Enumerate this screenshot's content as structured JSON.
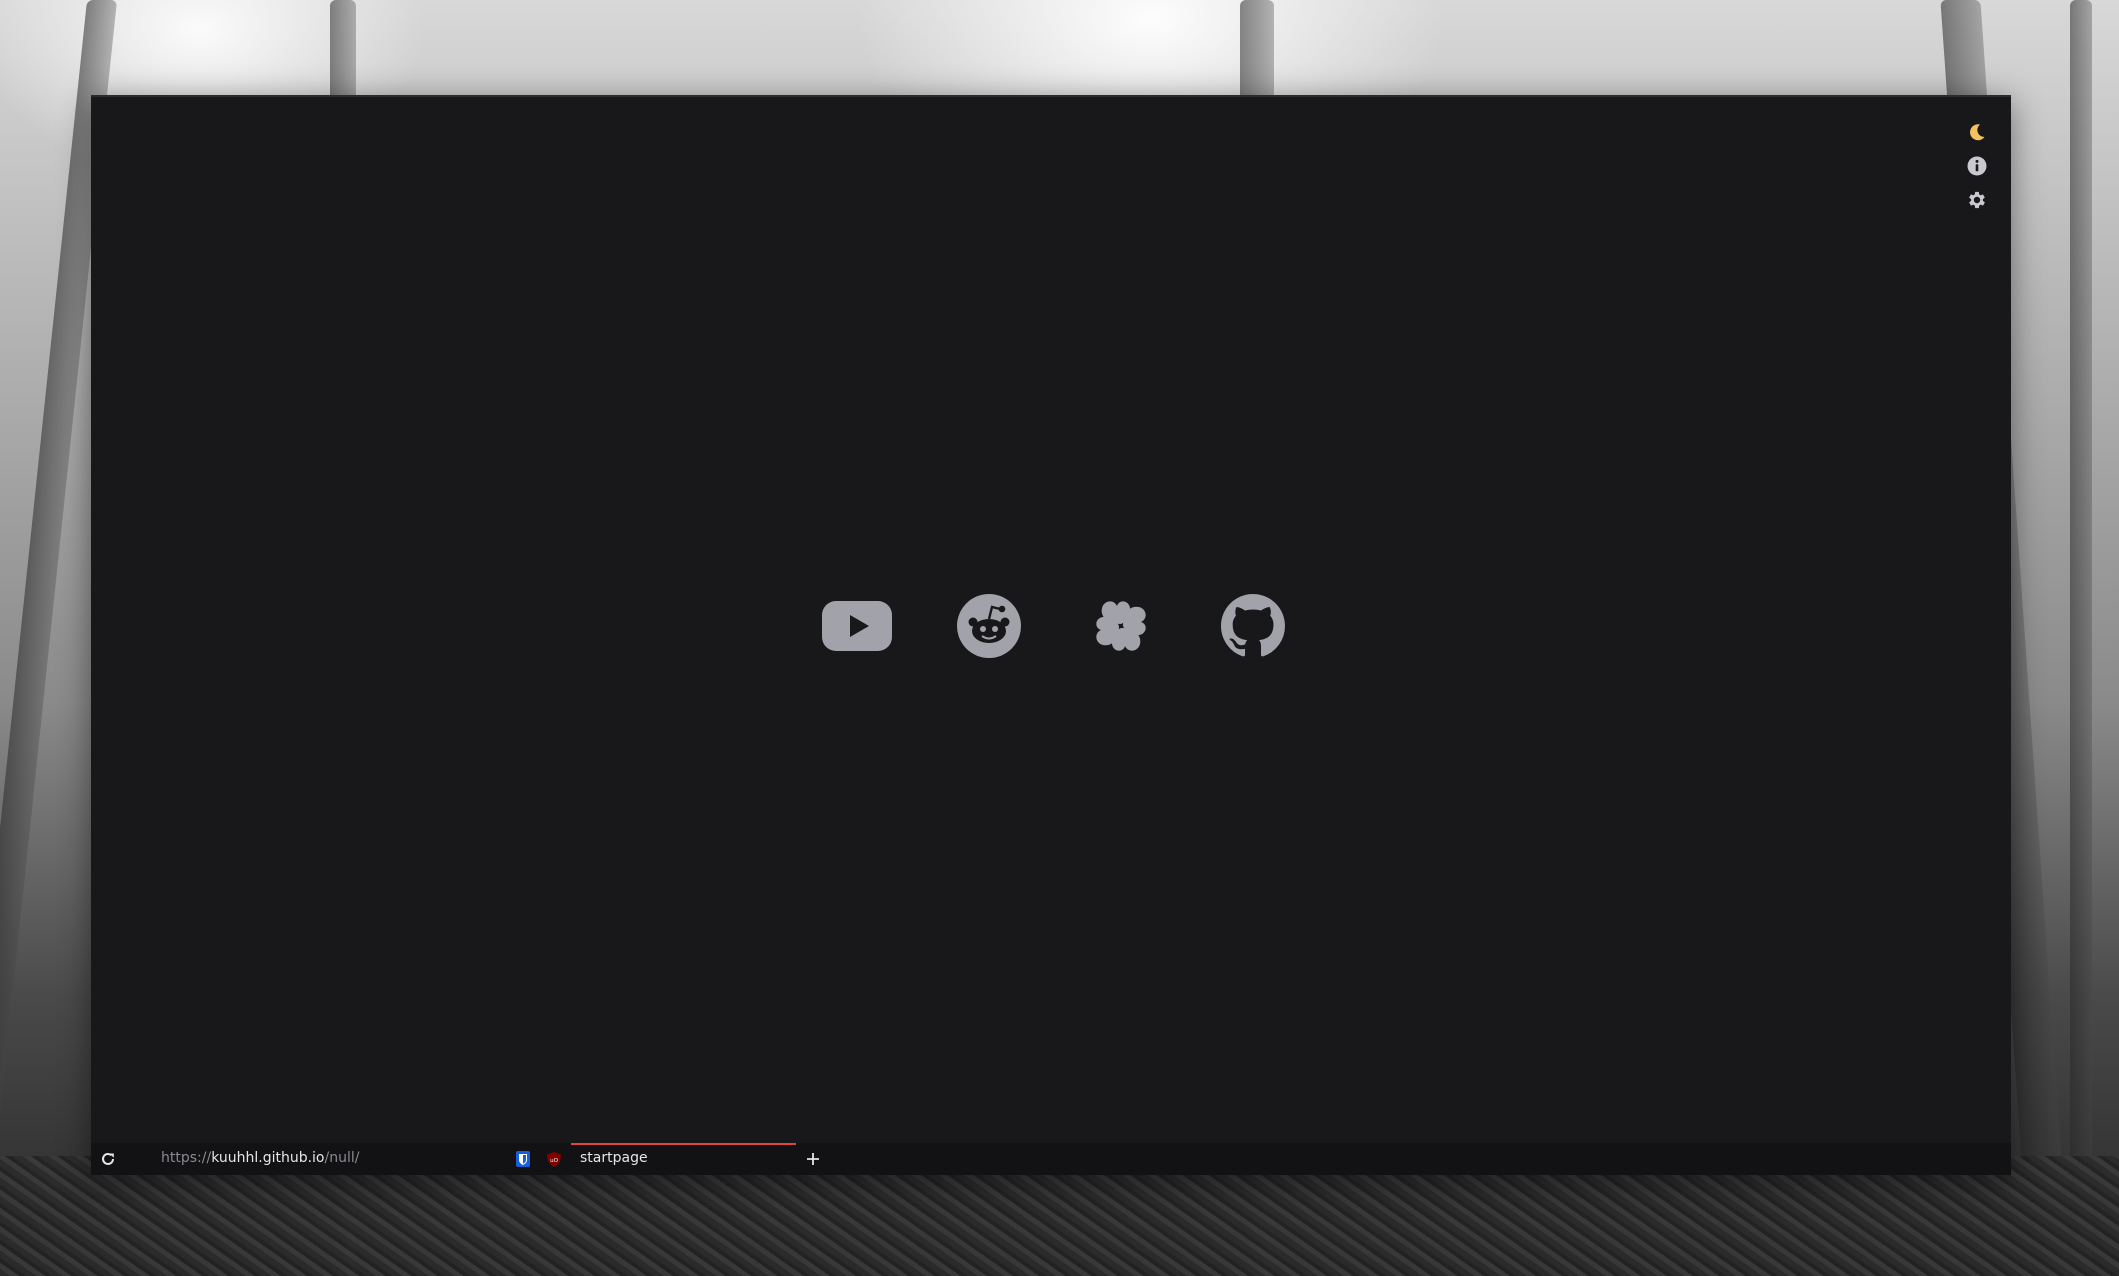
{
  "side_icons": [
    {
      "icon": "moon-icon",
      "color": "#f2c25f"
    },
    {
      "icon": "info-icon",
      "color": "#c9c9cf"
    },
    {
      "icon": "gear-icon",
      "color": "#c9c9cf"
    }
  ],
  "links": [
    {
      "icon": "youtube-icon"
    },
    {
      "icon": "reddit-icon"
    },
    {
      "icon": "clover-icon"
    },
    {
      "icon": "github-icon"
    }
  ],
  "link_color": "#a2a2aa",
  "statusbar": {
    "url_scheme": "https://",
    "url_host": "kuuhhl.github.io",
    "url_path": "/null/",
    "extensions": [
      {
        "icon": "bitwarden-icon",
        "color": "#175ddc"
      },
      {
        "icon": "ublock-origin-icon",
        "color": "#800000"
      }
    ],
    "tab_title": "startpage",
    "tab_accent": "#e0443c"
  }
}
